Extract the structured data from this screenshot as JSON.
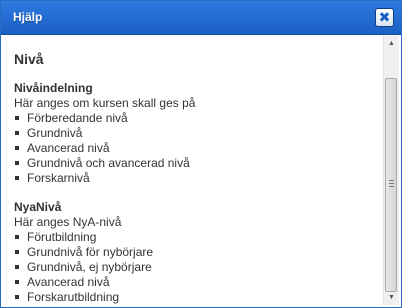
{
  "window": {
    "title": "Hjälp",
    "close_glyph": "✖"
  },
  "page": {
    "title": "Nivå"
  },
  "sections": [
    {
      "heading": "Nivåindelning",
      "description": "Här anges om kursen skall ges på",
      "items": [
        "Förberedande nivå",
        "Grundnivå",
        "Avancerad nivå",
        "Grundnivå och avancerad nivå",
        "Forskarnivå"
      ]
    },
    {
      "heading": "NyaNivå",
      "description": "Här anges NyA-nivå",
      "items": [
        "Förutbildning",
        "Grundnivå för nybörjare",
        "Grundnivå, ej nybörjare",
        "Avancerad nivå",
        "Forskarutbildning"
      ]
    }
  ],
  "scrollbar": {
    "up_glyph": "▲",
    "down_glyph": "▼"
  },
  "colors": {
    "titlebar": "#1a5fc4",
    "text": "#333333"
  }
}
